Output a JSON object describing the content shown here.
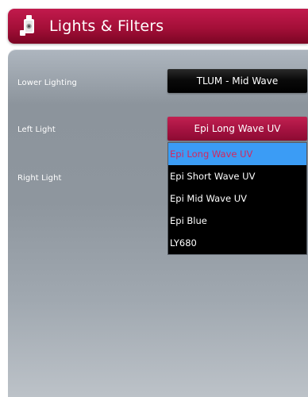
{
  "header": {
    "title": "Lights & Filters",
    "icon": "light-filter-icon"
  },
  "fields": {
    "lower_lighting": {
      "label": "Lower Lighting",
      "value": "TLUM - Mid Wave"
    },
    "left_light": {
      "label": "Left Light",
      "value": "Epi Long Wave UV"
    },
    "right_light": {
      "label": "Right Light"
    }
  },
  "dropdown": {
    "options": [
      "Epi Long Wave UV",
      "Epi Short Wave UV",
      "Epi Mid Wave UV",
      "Epi Blue",
      "LY680"
    ]
  },
  "colors": {
    "accent": "#a41240",
    "selected_highlight": "#3b9cf5",
    "selected_text": "#d4275e",
    "dropdown_background": "#000000",
    "panel_background": "#8c949c"
  }
}
